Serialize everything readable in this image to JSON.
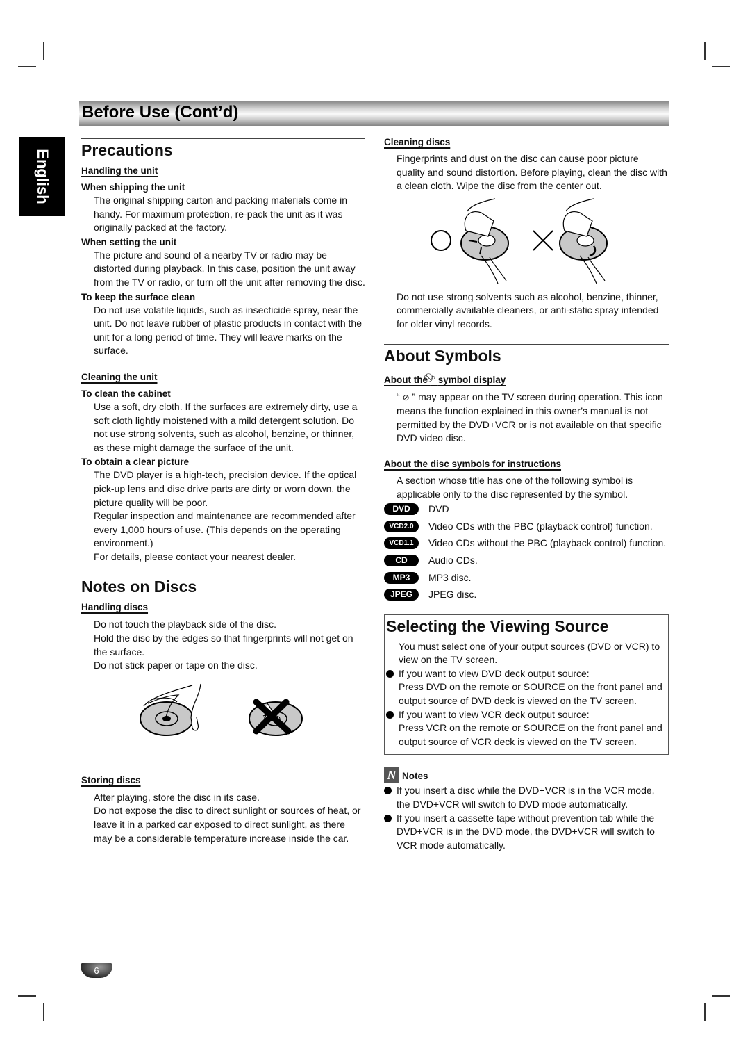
{
  "header": {
    "title": "Before Use (Cont’d)",
    "language_tab": "English"
  },
  "left": {
    "precautions": {
      "title": "Precautions",
      "handling_unit": {
        "heading": "Handling the unit",
        "shipping_title": "When shipping the unit",
        "shipping_text": "The original shipping carton and packing materials come in handy. For maximum protection, re-pack the unit as it was originally packed at the factory.",
        "setting_title": "When setting the unit",
        "setting_text": "The picture and sound of a nearby TV or radio may be distorted during playback. In this case, position the unit away from the TV or radio, or turn off the unit after removing the disc.",
        "surface_title": "To keep the surface clean",
        "surface_text": "Do not use volatile liquids, such as insecticide spray, near the unit. Do not leave rubber of plastic products in contact with the unit for a long period of time. They will leave marks on the surface."
      },
      "cleaning_unit": {
        "heading": "Cleaning the unit",
        "cabinet_title": "To clean the cabinet",
        "cabinet_text": "Use a soft, dry cloth. If the surfaces are extremely dirty, use a soft cloth lightly moistened with a mild detergent solution. Do not use strong solvents, such as alcohol, benzine, or thinner, as these might damage the surface of the unit.",
        "picture_title": "To obtain a clear picture",
        "picture_text1": "The DVD player is a high-tech, precision device. If the optical pick-up lens and disc drive parts are dirty or worn down, the picture quality will be poor.",
        "picture_text2": "Regular inspection and maintenance are recommended after every 1,000 hours of use. (This depends on the operating environment.)",
        "picture_text3": "For details, please contact your nearest dealer."
      }
    },
    "notes_on_discs": {
      "title": "Notes on Discs",
      "handling_heading": "Handling discs",
      "handling_lines": [
        "Do not touch the playback side of the disc.",
        "Hold the disc by the edges so that fingerprints will not get on the surface.",
        "Do not stick paper or tape on the disc."
      ],
      "storing_heading": "Storing discs",
      "storing_lines": [
        "After playing, store the disc in its case.",
        "Do not expose the disc to direct sunlight or sources of heat, or leave it in a parked car exposed to direct sunlight, as there may be a considerable temperature increase inside the car."
      ]
    }
  },
  "right": {
    "cleaning_discs": {
      "heading": "Cleaning discs",
      "text": "Fingerprints and dust on the disc can cause poor picture quality and sound distortion. Before playing, clean the disc with a clean cloth. Wipe the disc from the center out.",
      "warning": "Do not use strong solvents such as alcohol, benzine, thinner, commercially available cleaners, or anti-static spray intended for older vinyl records."
    },
    "about_symbols": {
      "title": "About Symbols",
      "symbol_heading_pre": "About the",
      "symbol_heading_post": "symbol display",
      "symbol_text_open": "“",
      "symbol_text": "” may appear on the TV screen during operation. This icon means the function explained in this owner’s manual is not permitted by the DVD+VCR or is not available on that specific DVD video disc.",
      "disc_heading": "About the disc symbols for instructions",
      "disc_intro": "A section whose title has one of the following symbol is applicable only to the disc represented by the symbol.",
      "symbols": [
        {
          "badge": "DVD",
          "desc": "DVD"
        },
        {
          "badge": "VCD2.0",
          "desc": "Video CDs with the PBC (playback control) function."
        },
        {
          "badge": "VCD1.1",
          "desc": "Video CDs without the PBC (playback control) function."
        },
        {
          "badge": "CD",
          "desc": "Audio CDs."
        },
        {
          "badge": "MP3",
          "desc": "MP3 disc."
        },
        {
          "badge": "JPEG",
          "desc": "JPEG disc."
        }
      ]
    },
    "viewing_source": {
      "title": "Selecting the Viewing Source",
      "intro": "You must select one of your output sources (DVD or VCR) to view on the TV screen.",
      "bullets": [
        {
          "head": "If you want to view DVD deck output source:",
          "body": "Press DVD on the remote or SOURCE on the front panel and output source of DVD deck is viewed on the TV screen."
        },
        {
          "head": "If you want to view VCR deck output source:",
          "body": "Press VCR on the remote or SOURCE on the front panel and output source of VCR deck is viewed on the TV screen."
        }
      ]
    },
    "notes": {
      "icon_letter": "N",
      "title": "Notes",
      "items": [
        "If you insert a disc while the DVD+VCR is in the VCR mode, the DVD+VCR will switch to DVD mode automatically.",
        "If you insert a cassette tape without prevention tab while the DVD+VCR is in the DVD mode, the DVD+VCR will switch to VCR mode automatically."
      ]
    }
  },
  "footer": {
    "page_number": "6"
  }
}
